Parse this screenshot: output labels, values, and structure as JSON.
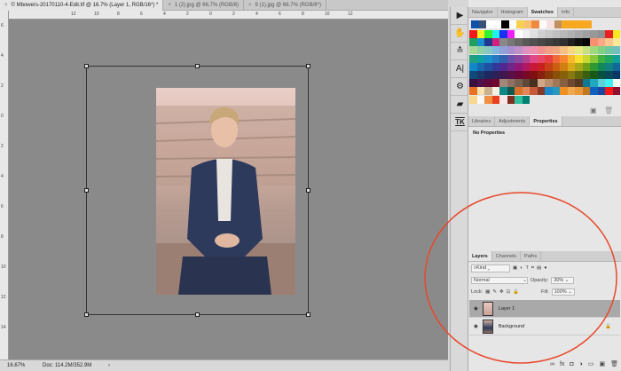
{
  "tabs": [
    {
      "label": "© Mbowers-20170110-4-Edit.tif @ 16.7% (Layer 1, RGB/16*) *",
      "active": true
    },
    {
      "label": "1 (2).jpg @ 66.7% (RGB/8)",
      "active": false
    },
    {
      "label": "9 (1).jpg @ 66.7% (RGB/8*)",
      "active": false
    }
  ],
  "ruler_top": [
    "12",
    "10",
    "8",
    "6",
    "4",
    "2",
    "0",
    "2",
    "4",
    "6",
    "8",
    "10",
    "12"
  ],
  "ruler_left": [
    "6",
    "4",
    "2",
    "0",
    "2",
    "4",
    "6",
    "8",
    "10",
    "12",
    "14"
  ],
  "status": {
    "zoom": "16.67%",
    "doc": "Doc: 114.2M/352.9M",
    "arrow": "›"
  },
  "tools": [
    "play-icon",
    "brush-settings-icon",
    "sliders-icon",
    "character-icon",
    "share-icon",
    "folder-icon",
    "tk-icon"
  ],
  "tools_text": {
    "char": "A|",
    "tk": "TK"
  },
  "swatch_panel": {
    "tabs": [
      "Navigator",
      "Histogram",
      "Swatches",
      "Info"
    ],
    "active": "Swatches",
    "recent": [
      "#1150a8",
      "#3a5078",
      "#ffffff",
      "#ffffff",
      "#000000",
      "#ffffff",
      "#f8d050",
      "#f8c070",
      "#f08840",
      "#ffffff",
      "#f8e0e0",
      "#c09060",
      "#f8a820",
      "#f8a820",
      "#f8a820",
      "#f8a820"
    ],
    "rows": [
      [
        "#f01818",
        "#f8f020",
        "#30f030",
        "#20f0f0",
        "#1830f0",
        "#f020f0",
        "#ffffff",
        "#f0f0f0",
        "#e0e0e0",
        "#d0d0d0",
        "#c8c8c8",
        "#c0c0c0",
        "#b8b8b8",
        "#b0b0b0",
        "#a8a8a8",
        "#a0a0a0",
        "#989898",
        "#909090",
        "#e82020",
        "#f8e820"
      ],
      [
        "#20a060",
        "#1890d0",
        "#203890",
        "#d02080",
        "#888888",
        "#787878",
        "#686868",
        "#585858",
        "#505050",
        "#484848",
        "#404040",
        "#383838",
        "#303030",
        "#202020",
        "#101010",
        "#000000",
        "#f89070",
        "#f8a888",
        "#f8c890",
        "#f8e898"
      ],
      [
        "#a8d898",
        "#90d0a8",
        "#88c8c0",
        "#80b8e0",
        "#90a0d8",
        "#a890d0",
        "#c090c8",
        "#e090c0",
        "#f090b0",
        "#f09090",
        "#f0a088",
        "#f0a880",
        "#f8c080",
        "#f8d880",
        "#e8e880",
        "#c8e080",
        "#a0d880",
        "#80d080",
        "#70c8a0",
        "#70c0c0"
      ],
      [
        "#20a080",
        "#10a0a0",
        "#1890c8",
        "#2878c0",
        "#3060b0",
        "#6850a8",
        "#8848a0",
        "#b04090",
        "#e04888",
        "#e84868",
        "#e84040",
        "#f06838",
        "#f88830",
        "#f8b830",
        "#f8e030",
        "#c8d830",
        "#88c838",
        "#40b040",
        "#20a860",
        "#10a098"
      ],
      [
        "#1088c8",
        "#1868b0",
        "#2050a0",
        "#303898",
        "#502890",
        "#702888",
        "#901878",
        "#b01860",
        "#c81838",
        "#c82020",
        "#c84018",
        "#c86010",
        "#d08010",
        "#d8a818",
        "#a8a818",
        "#70a018",
        "#309830",
        "#108858",
        "#108080",
        "#106898"
      ],
      [
        "#104878",
        "#183868",
        "#202860",
        "#302058",
        "#401850",
        "#581048",
        "#680838",
        "#780828",
        "#801010",
        "#882010",
        "#883808",
        "#885008",
        "#886008",
        "#887810",
        "#606810",
        "#386010",
        "#185818",
        "#085040",
        "#084858",
        "#083868"
      ],
      [
        "#381040",
        "#501048",
        "#600838",
        "#700830",
        "#a08878",
        "#907060",
        "#786050",
        "#604838",
        "#483020",
        "#d0a888",
        "#b89070",
        "#a07858",
        "#886040",
        "#704830",
        "#583820",
        "#107890",
        "#20a8c0",
        "#60d0d8",
        "#40f0f0",
        "#f0fff0"
      ],
      [
        "#e87020",
        "#f8e0b0",
        "#c8b090",
        "#f8f0e0",
        "#108888",
        "#105850",
        "#d87028",
        "#e08858",
        "#c85838",
        "#883828",
        "#1888c8",
        "#2898c0",
        "#f09020",
        "#f0a850",
        "#e89838",
        "#c07820",
        "#1060c0",
        "#1848a0",
        "#f81818",
        "#901030"
      ],
      [
        "#f8d890",
        "#f8f8f8",
        "#f09040",
        "#e84020",
        "#f8e8e8",
        "#803020",
        "#30c0a0",
        "#008070"
      ]
    ]
  },
  "properties_panel": {
    "tabs": [
      "Libraries",
      "Adjustments",
      "Properties"
    ],
    "active": "Properties",
    "content": "No Properties"
  },
  "layers_panel": {
    "tabs": [
      "Layers",
      "Channels",
      "Paths"
    ],
    "active": "Layers",
    "filter": "Kind",
    "blend_mode": "Normal",
    "opacity_label": "Opacity:",
    "opacity": "30%",
    "lock_label": "Lock:",
    "fill_label": "Fill:",
    "fill": "100%",
    "layers": [
      {
        "name": "Layer 1",
        "selected": true,
        "locked": false
      },
      {
        "name": "Background",
        "selected": false,
        "locked": true
      }
    ]
  },
  "annotation_color": "#e8482a"
}
